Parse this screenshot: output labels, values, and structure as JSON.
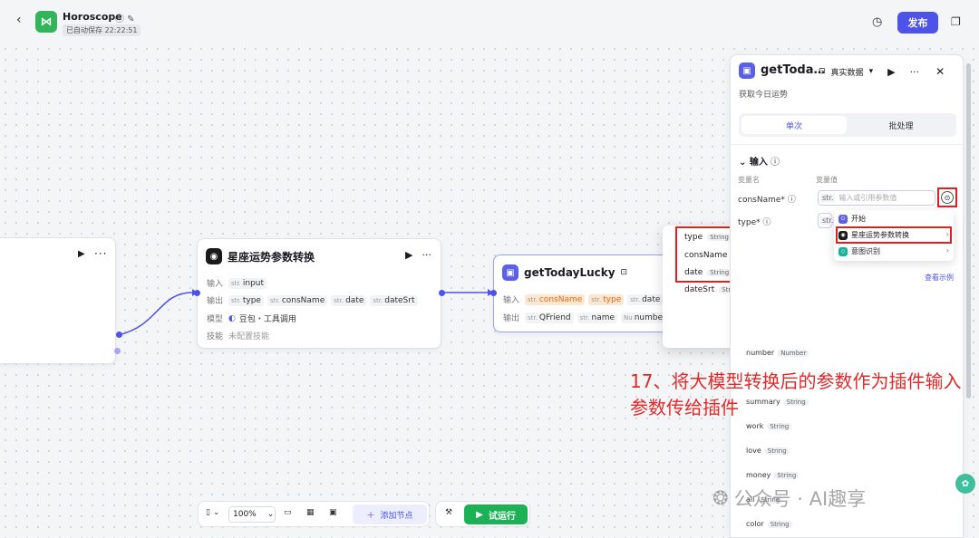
{
  "header": {
    "back_icon": "chevron-left-icon",
    "app_title": "Horoscope",
    "saved_status": "已自动保存 22:22:51",
    "publish_label": "发布"
  },
  "left_node": {
    "run_icon": "▶",
    "more_icon": "···"
  },
  "llm_node": {
    "title": "星座运势参数转换",
    "input_label": "输入",
    "inputs": [
      {
        "type": "str.",
        "name": "input"
      }
    ],
    "output_label": "输出",
    "outputs": [
      {
        "type": "str.",
        "name": "type"
      },
      {
        "type": "str.",
        "name": "consName"
      },
      {
        "type": "str.",
        "name": "date"
      },
      {
        "type": "str.",
        "name": "dateSrt"
      }
    ],
    "model_label": "模型",
    "model_value": "豆包・工具调用",
    "skill_label": "技能",
    "skill_value": "未配置技能"
  },
  "plugin_node": {
    "title": "getTodayLucky",
    "input_label": "输入",
    "inputs": [
      {
        "type": "str.",
        "name": "consName"
      },
      {
        "type": "str.",
        "name": "type"
      },
      {
        "type": "str.",
        "name": "date"
      }
    ],
    "output_label": "输出",
    "outputs": [
      {
        "type": "str.",
        "name": "QFriend"
      },
      {
        "type": "str.",
        "name": "name"
      },
      {
        "type": "Nu",
        "name": "number"
      }
    ]
  },
  "popup_vars": [
    {
      "name": "type",
      "type": "String"
    },
    {
      "name": "consName",
      "type": "String"
    },
    {
      "name": "date",
      "type": "String"
    },
    {
      "name": "dateSrt",
      "type": "String"
    }
  ],
  "panel": {
    "title": "getToda…",
    "data_mode": "真实数据",
    "description": "获取今日运势",
    "tab_single": "单次",
    "tab_batch": "批处理",
    "input_section": "输入",
    "col_var_name": "变量名",
    "col_var_value": "变量值",
    "var1": "consName*",
    "var2": "type*",
    "input_type": "str.",
    "input_placeholder": "输入或引用参数值",
    "menu": [
      {
        "label": "开始",
        "color": "#5a5fe8"
      },
      {
        "label": "星座运势参数转换",
        "color": "#1a1a1a"
      },
      {
        "label": "意图识别",
        "color": "#16b39a"
      }
    ],
    "view_example": "查看示例",
    "outputs": [
      {
        "name": "number",
        "type": "Number"
      },
      {
        "name": "summary",
        "type": "String"
      },
      {
        "name": "work",
        "type": "String"
      },
      {
        "name": "love",
        "type": "String"
      },
      {
        "name": "money",
        "type": "String"
      },
      {
        "name": "all",
        "type": "String"
      },
      {
        "name": "color",
        "type": "String"
      }
    ]
  },
  "annotation": "17、将大模型转换后的参数作为插件输入参数传给插件",
  "watermark": "公众号 · AI趣享",
  "toolbar": {
    "zoom": "100%",
    "add_node": "添加节点",
    "run": "试运行"
  }
}
